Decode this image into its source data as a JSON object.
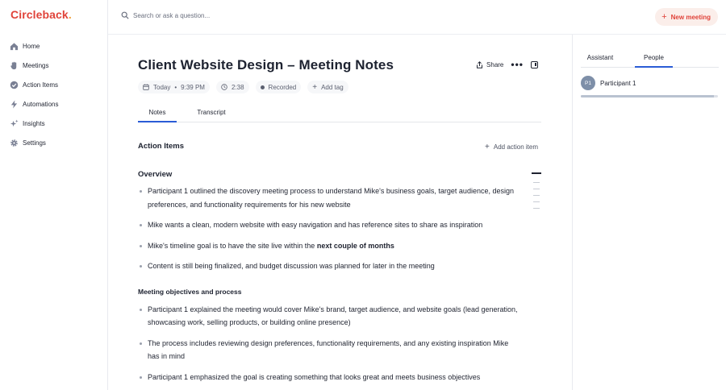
{
  "app": {
    "logo_text": "Circleback",
    "logo_dot": ".",
    "brand_color": "#e0433a"
  },
  "sidebar": {
    "items": [
      {
        "label": "Home",
        "icon": "home-icon"
      },
      {
        "label": "Meetings",
        "icon": "meetings-icon"
      },
      {
        "label": "Action Items",
        "icon": "check-circle-icon"
      },
      {
        "label": "Automations",
        "icon": "bolt-icon"
      },
      {
        "label": "Insights",
        "icon": "sparkle-icon"
      },
      {
        "label": "Settings",
        "icon": "gear-icon"
      }
    ]
  },
  "topbar": {
    "search_placeholder": "Search or ask a question...",
    "new_meeting_label": "New meeting"
  },
  "meeting": {
    "title": "Client Website Design – Meeting Notes",
    "share_label": "Share",
    "date": "Today",
    "time": "9:39 PM",
    "duration": "2:38",
    "recorded_label": "Recorded",
    "add_tag_label": "Add tag",
    "tabs": [
      {
        "label": "Notes",
        "active": true
      },
      {
        "label": "Transcript",
        "active": false
      }
    ],
    "action_items_heading": "Action Items",
    "add_action_label": "Add action item",
    "overview_heading": "Overview",
    "overview_bullets": [
      "Participant 1 outlined the discovery meeting process to understand Mike's business goals, target audience, design preferences, and functionality requirements for his new website",
      "Mike wants a clean, modern website with easy navigation and has reference sites to share as inspiration"
    ],
    "timeline_pre": "Mike's timeline goal is to have the site live within the ",
    "timeline_bold": "next couple of months",
    "content_bullet": "Content is still being finalized, and budget discussion was planned for later in the meeting",
    "objectives_heading": "Meeting objectives and process",
    "objectives_bullets": [
      "Participant 1 explained the meeting would cover Mike's brand, target audience, and website goals (lead generation, showcasing work, selling products, or building online presence)",
      "The process includes reviewing design preferences, functionality requirements, and any existing inspiration Mike has in mind",
      "Participant 1 emphasized the goal is creating something that looks great and meets business objectives"
    ]
  },
  "right_panel": {
    "tabs": [
      {
        "label": "Assistant",
        "active": false
      },
      {
        "label": "People",
        "active": true
      }
    ],
    "people": [
      {
        "initials": "P1",
        "name": "Participant 1",
        "talk_share": 0.97
      }
    ]
  }
}
